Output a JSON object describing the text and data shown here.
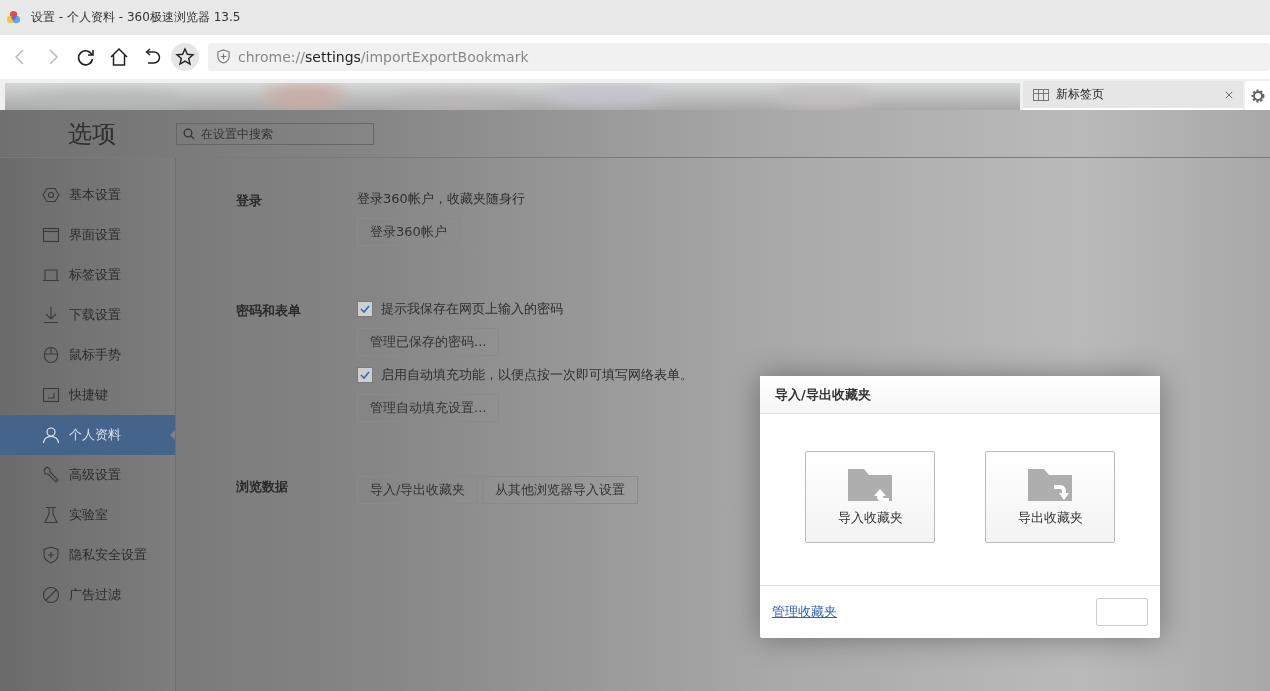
{
  "window": {
    "title": "设置 - 个人资料 - 360极速浏览器 13.5"
  },
  "address": {
    "scheme": "chrome://",
    "host": "settings",
    "path": "/importExportBookmark"
  },
  "tabs": [
    {
      "label": "新标签页",
      "selected": true
    }
  ],
  "page": {
    "heading": "选项",
    "search": {
      "placeholder": "在设置中搜索"
    }
  },
  "sidebar": {
    "items": [
      {
        "label": "基本设置",
        "selected": false
      },
      {
        "label": "界面设置",
        "selected": false
      },
      {
        "label": "标签设置",
        "selected": false
      },
      {
        "label": "下载设置",
        "selected": false
      },
      {
        "label": "鼠标手势",
        "selected": false
      },
      {
        "label": "快捷键",
        "selected": false
      },
      {
        "label": "个人资料",
        "selected": true
      },
      {
        "label": "高级设置",
        "selected": false
      },
      {
        "label": "实验室",
        "selected": false
      },
      {
        "label": "隐私安全设置",
        "selected": false
      },
      {
        "label": "广告过滤",
        "selected": false
      }
    ]
  },
  "sections": [
    {
      "label": "登录",
      "items": [
        {
          "kind": "text",
          "label": "登录360帐户，收藏夹随身行"
        },
        {
          "kind": "button",
          "label": "登录360帐户"
        }
      ]
    },
    {
      "label": "密码和表单",
      "items": [
        {
          "kind": "checkbox",
          "label": "提示我保存在网页上输入的密码",
          "checked": true
        },
        {
          "kind": "button",
          "label": "管理已保存的密码..."
        },
        {
          "kind": "checkbox",
          "label": "启用自动填充功能，以便点按一次即可填写网络表单。",
          "checked": true
        },
        {
          "kind": "button",
          "label": "管理自动填充设置..."
        }
      ]
    },
    {
      "label": "浏览数据",
      "items": [
        {
          "kind": "buttons",
          "labels": [
            "导入/导出收藏夹",
            "从其他浏览器导入设置"
          ]
        }
      ]
    }
  ],
  "dialog": {
    "title": "导入/导出收藏夹",
    "options": [
      {
        "kind": "import",
        "label": "导入收藏夹"
      },
      {
        "kind": "export",
        "label": "导出收藏夹"
      }
    ],
    "link": "管理收藏夹"
  }
}
